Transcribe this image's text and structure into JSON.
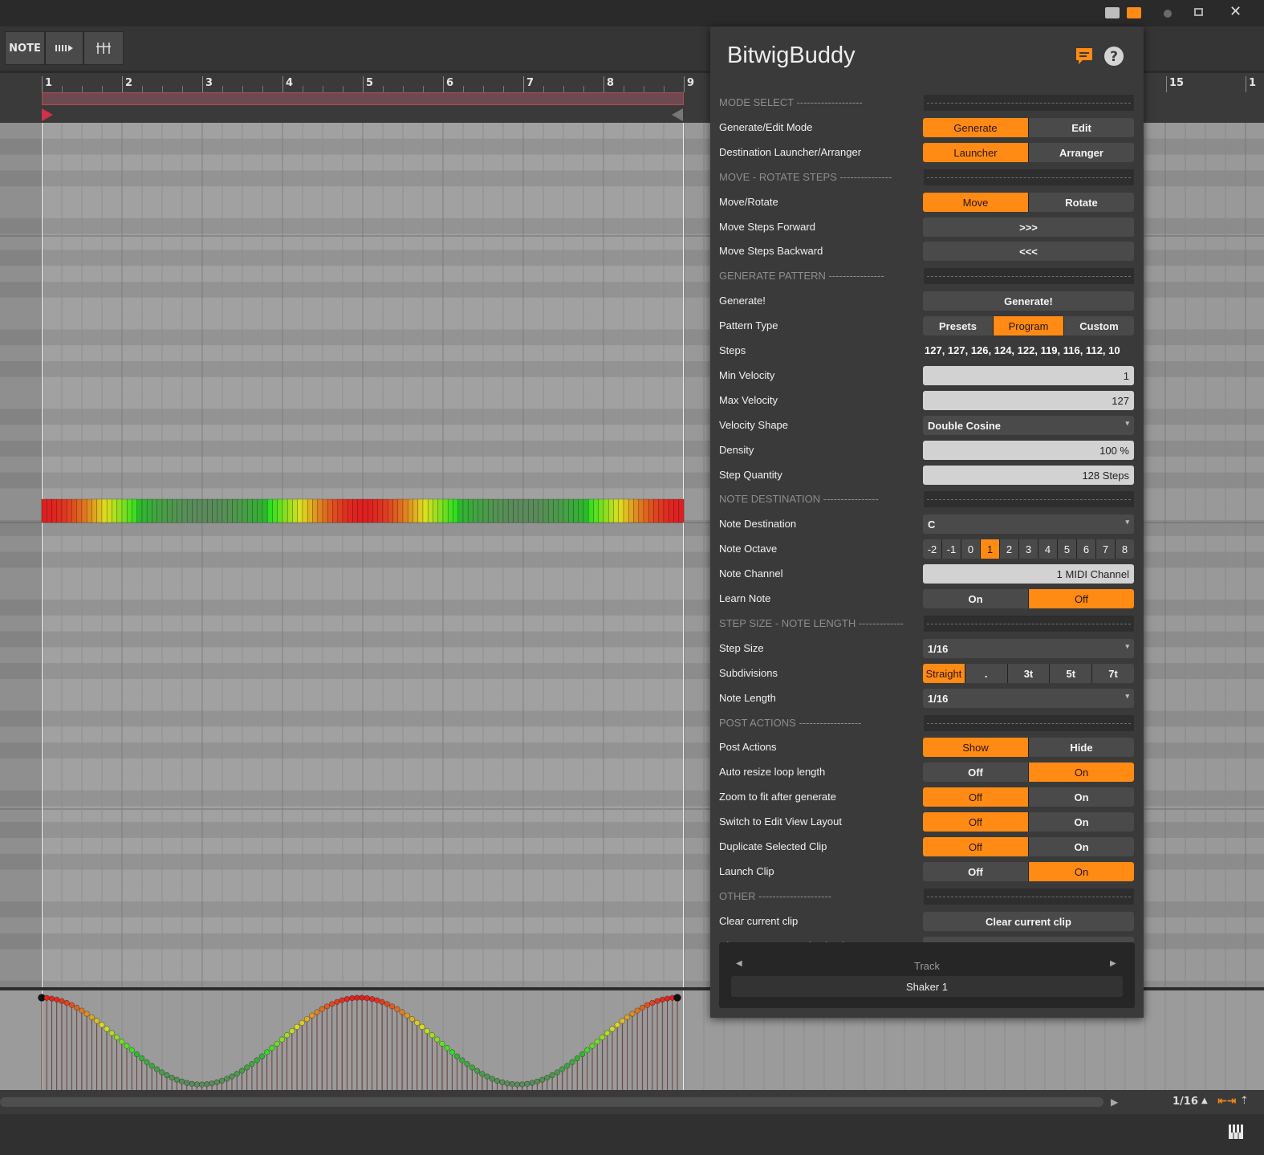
{
  "toolbar": {
    "note_label": "NOTE"
  },
  "ruler": {
    "bars": [
      "1",
      "2",
      "3",
      "4",
      "5",
      "6",
      "7",
      "8",
      "9"
    ],
    "far_bars": [
      "15",
      "1"
    ]
  },
  "status": {
    "grid_value": "1/16"
  },
  "panel": {
    "title": "BitwigBuddy",
    "rows": [
      {
        "type": "section",
        "label": "MODE SELECT -------------------"
      },
      {
        "type": "seg",
        "label": "Generate/Edit Mode",
        "options": [
          "Generate",
          "Edit"
        ],
        "active": 0
      },
      {
        "type": "seg",
        "label": "Destination Launcher/Arranger",
        "options": [
          "Launcher",
          "Arranger"
        ],
        "active": 0
      },
      {
        "type": "section",
        "label": "MOVE - ROTATE STEPS ---------------"
      },
      {
        "type": "seg",
        "label": "Move/Rotate",
        "options": [
          "Move",
          "Rotate"
        ],
        "active": 0
      },
      {
        "type": "button",
        "label": "Move Steps Forward",
        "text": ">>>"
      },
      {
        "type": "button",
        "label": "Move Steps Backward",
        "text": "<<<"
      },
      {
        "type": "section",
        "label": "GENERATE PATTERN ----------------"
      },
      {
        "type": "button",
        "label": "Generate!",
        "text": "Generate!"
      },
      {
        "type": "seg",
        "label": "Pattern Type",
        "options": [
          "Presets",
          "Program",
          "Custom"
        ],
        "active": 1
      },
      {
        "type": "text",
        "label": "Steps",
        "value": "127, 127, 126, 124, 122, 119, 116, 112, 10"
      },
      {
        "type": "number",
        "label": "Min Velocity",
        "value": "1"
      },
      {
        "type": "number",
        "label": "Max Velocity",
        "value": "127"
      },
      {
        "type": "select",
        "label": "Velocity Shape",
        "value": "Double Cosine"
      },
      {
        "type": "number",
        "label": "Density",
        "value": "100 %"
      },
      {
        "type": "number",
        "label": "Step Quantity",
        "value": "128 Steps"
      },
      {
        "type": "section",
        "label": "NOTE DESTINATION ----------------"
      },
      {
        "type": "select",
        "label": "Note Destination",
        "value": "C"
      },
      {
        "type": "seg",
        "label": "Note Octave",
        "options": [
          "-2",
          "-1",
          "0",
          "1",
          "2",
          "3",
          "4",
          "5",
          "6",
          "7",
          "8"
        ],
        "active": 3
      },
      {
        "type": "number",
        "label": "Note Channel",
        "value": "1 MIDI Channel"
      },
      {
        "type": "seg",
        "label": "Learn Note",
        "options": [
          "On",
          "Off"
        ],
        "active": 1
      },
      {
        "type": "section",
        "label": "STEP SIZE - NOTE LENGTH -------------"
      },
      {
        "type": "select",
        "label": "Step Size",
        "value": "1/16"
      },
      {
        "type": "seg",
        "label": "Subdivisions",
        "options": [
          "Straight",
          ".",
          "3t",
          "5t",
          "7t"
        ],
        "active": 0
      },
      {
        "type": "select",
        "label": "Note Length",
        "value": "1/16"
      },
      {
        "type": "section",
        "label": "POST ACTIONS ------------------"
      },
      {
        "type": "seg",
        "label": "Post Actions",
        "options": [
          "Show",
          "Hide"
        ],
        "active": 0
      },
      {
        "type": "seg",
        "label": "Auto resize loop length",
        "options": [
          "Off",
          "On"
        ],
        "active": 1
      },
      {
        "type": "seg",
        "label": "Zoom to fit after generate",
        "options": [
          "Off",
          "On"
        ],
        "active": 0
      },
      {
        "type": "seg",
        "label": "Switch to Edit View Layout",
        "options": [
          "Off",
          "On"
        ],
        "active": 0
      },
      {
        "type": "seg",
        "label": "Duplicate Selected Clip",
        "options": [
          "Off",
          "On"
        ],
        "active": 0
      },
      {
        "type": "seg",
        "label": "Launch Clip",
        "options": [
          "Off",
          "On"
        ],
        "active": 1
      },
      {
        "type": "section",
        "label": "OTHER ---------------------"
      },
      {
        "type": "button",
        "label": "Clear current clip",
        "text": "Clear current clip"
      },
      {
        "type": "button",
        "label": "Clear current note destination",
        "text": "Clear current note destination"
      }
    ],
    "track": {
      "header": "Track",
      "name": "Shaker 1"
    }
  },
  "colors": {
    "accent": "#ff8a14",
    "panel_bg": "#3a3a3a",
    "grid_bg": "#9d9d9d"
  }
}
